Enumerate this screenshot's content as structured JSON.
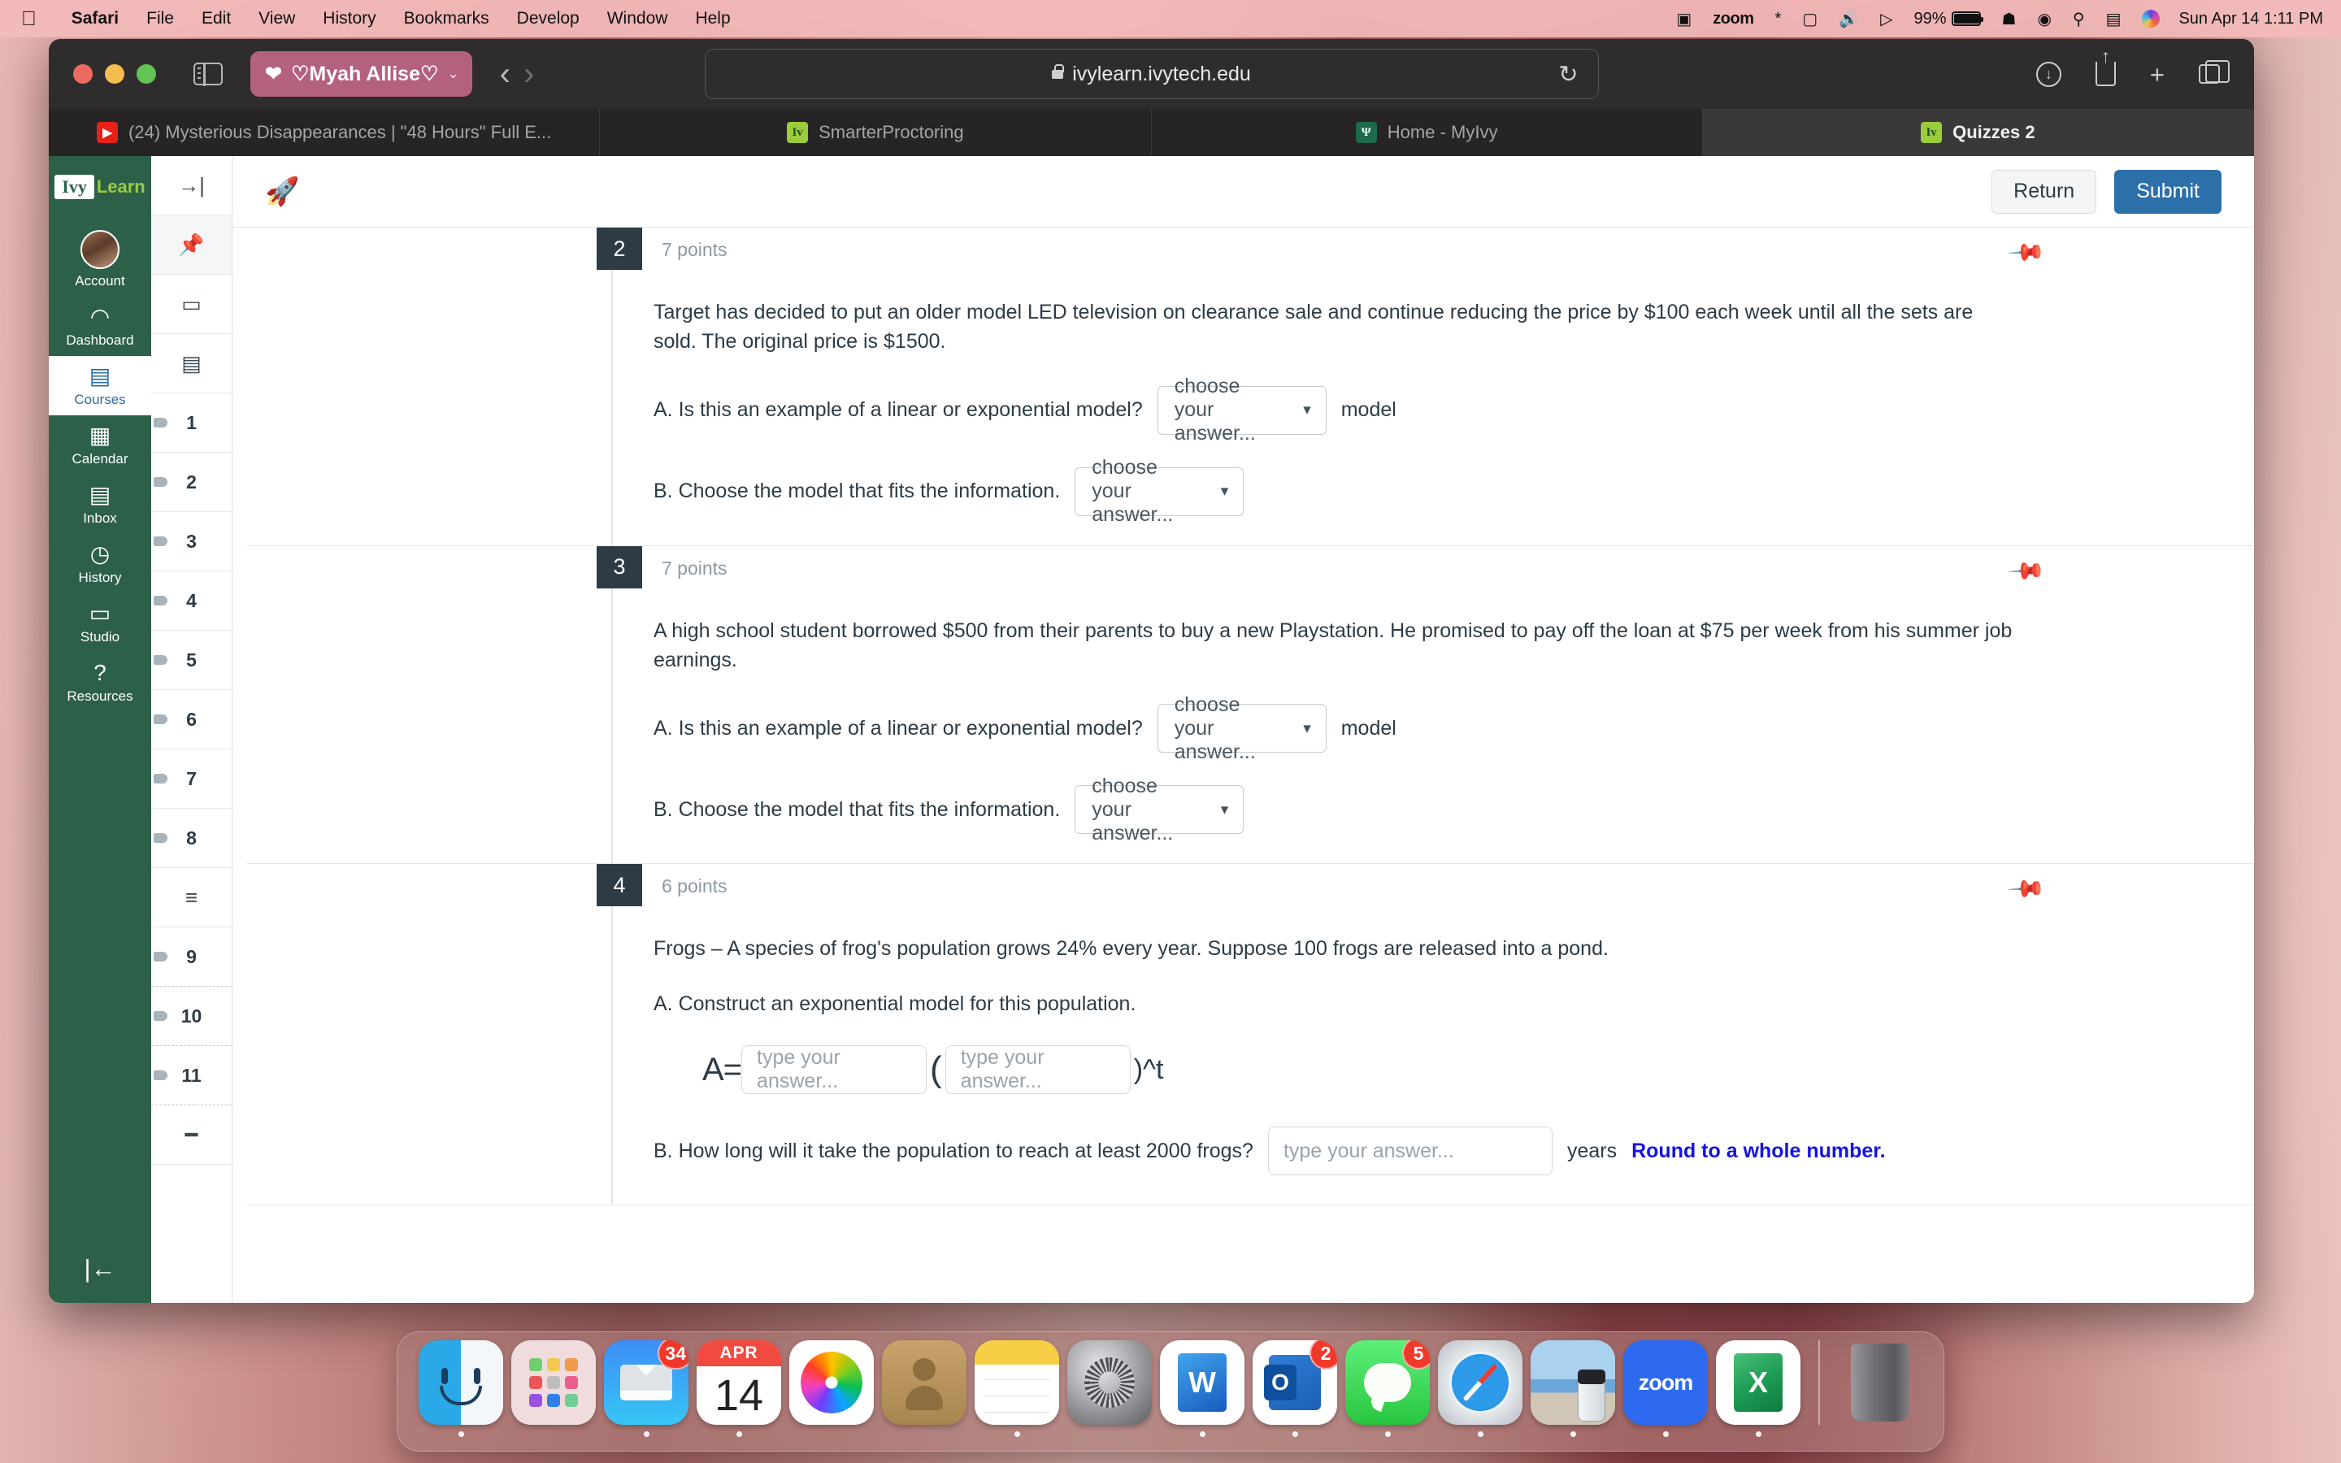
{
  "menubar": {
    "apple_icon": "apple-icon",
    "items": [
      "Safari",
      "File",
      "Edit",
      "View",
      "History",
      "Bookmarks",
      "Develop",
      "Window",
      "Help"
    ],
    "status": {
      "screenshot_icon": "screenshot-icon",
      "zoom_label": "zoom",
      "bluetooth_icon": "bluetooth-icon",
      "display_icon": "display-icon",
      "volume_icon": "volume-icon",
      "playback_icon": "playback-icon",
      "battery_percent": "99%",
      "wifi_icon": "wifi-icon",
      "user_icon": "user-icon",
      "search_icon": "search-icon",
      "controlcenter_icon": "control-center-icon",
      "siri_icon": "siri-icon",
      "clock": "Sun Apr 14  1:11 PM"
    }
  },
  "safari": {
    "sidebar_icon": "sidebar-toggle-icon",
    "profile_label": "♡Myah Allise♡",
    "profile_heart_icon": "heart-icon",
    "profile_chevron": "⌄",
    "back_icon": "‹",
    "forward_icon": "›",
    "url": "ivylearn.ivytech.edu",
    "lock_icon": "lock-icon",
    "reload_icon": "↻",
    "download_icon": "download-icon",
    "share_icon": "share-icon",
    "newtab_icon": "+",
    "tabs_overview_icon": "tab-overview-icon",
    "tabs": [
      {
        "title": "(24) Mysterious Disappearances | \"48 Hours\" Full E...",
        "favicon": "youtube-icon",
        "favicon_glyph": "▶",
        "active": false
      },
      {
        "title": "SmarterProctoring",
        "favicon": "ivylearn-icon",
        "favicon_glyph": "Iv",
        "active": false
      },
      {
        "title": "Home - MyIvy",
        "favicon": "myivy-icon",
        "favicon_glyph": "Ψ",
        "active": false
      },
      {
        "title": "Quizzes 2",
        "favicon": "ivylearn-icon",
        "favicon_glyph": "Iv",
        "active": true
      }
    ]
  },
  "ivynav": {
    "logo_ivy": "Ivy",
    "logo_learn": "Learn",
    "items": [
      {
        "label": "Account",
        "icon": "avatar-icon",
        "glyph": "",
        "selected": false
      },
      {
        "label": "Dashboard",
        "icon": "dashboard-icon",
        "glyph": "◠",
        "selected": false
      },
      {
        "label": "Courses",
        "icon": "courses-icon",
        "glyph": "▤",
        "selected": true
      },
      {
        "label": "Calendar",
        "icon": "calendar-icon",
        "glyph": "▦",
        "selected": false
      },
      {
        "label": "Inbox",
        "icon": "inbox-icon",
        "glyph": "▤",
        "selected": false
      },
      {
        "label": "History",
        "icon": "clock-icon",
        "glyph": "◷",
        "selected": false
      },
      {
        "label": "Studio",
        "icon": "studio-icon",
        "glyph": "▭",
        "selected": false
      },
      {
        "label": "Resources",
        "icon": "help-icon",
        "glyph": "?",
        "selected": false
      }
    ],
    "collapse_icon": "collapse-sidebar-icon",
    "collapse_glyph": "|←"
  },
  "qrail": {
    "rows": [
      {
        "type": "icon",
        "label": "→|",
        "name": "jump-to-icon",
        "shaded": false
      },
      {
        "type": "icon",
        "label": "📌",
        "name": "pin-icon",
        "shaded": true
      },
      {
        "type": "icon",
        "label": "▭",
        "name": "question-group-icon",
        "shaded": false
      },
      {
        "type": "icon",
        "label": "▤",
        "name": "text-block-icon",
        "shaded": false
      },
      {
        "type": "num",
        "label": "1",
        "flag": true
      },
      {
        "type": "num",
        "label": "2",
        "flag": true
      },
      {
        "type": "num",
        "label": "3",
        "flag": true
      },
      {
        "type": "num",
        "label": "4",
        "flag": true
      },
      {
        "type": "num",
        "label": "5",
        "flag": true
      },
      {
        "type": "num",
        "label": "6",
        "flag": true
      },
      {
        "type": "num",
        "label": "7",
        "flag": true
      },
      {
        "type": "num",
        "label": "8",
        "flag": true
      },
      {
        "type": "icon",
        "label": "≡",
        "name": "section-divider-icon",
        "shaded": false
      },
      {
        "type": "num",
        "label": "9",
        "flag": true,
        "dashed": true
      },
      {
        "type": "num",
        "label": "10",
        "flag": true,
        "dashed": true
      },
      {
        "type": "num",
        "label": "11",
        "flag": true,
        "dashed": true
      }
    ]
  },
  "quiz": {
    "rocket_icon": "rocket-icon",
    "return_label": "Return",
    "submit_label": "Submit",
    "pin_icon": "pin-icon",
    "questions": [
      {
        "number": "2",
        "points": "7 points",
        "text": "Target has decided to put an older model LED television on clearance sale and continue reducing the price by $100 each week until all the sets are sold.  The original price is $1500.",
        "parts": [
          {
            "label": "A.  Is this an example of a linear or exponential model?",
            "select_value": "choose your answer...",
            "suffix": "model",
            "select_width": 208
          },
          {
            "label": "B. Choose the model that fits the information.",
            "select_value": "choose your answer...",
            "suffix": "",
            "select_width": 208
          }
        ]
      },
      {
        "number": "3",
        "points": "7 points",
        "text": "A high school student borrowed $500 from their parents to buy a new Playstation. He promised to pay off the loan at $75 per week from his summer job earnings.",
        "parts": [
          {
            "label": "A. Is this an example of a linear or exponential model?",
            "select_value": "choose your answer...",
            "suffix": "model",
            "select_width": 208
          },
          {
            "label": "B. Choose the model that fits the information.",
            "select_value": "choose your answer...",
            "suffix": "",
            "select_width": 208
          }
        ]
      },
      {
        "number": "4",
        "points": "6 points",
        "text": "Frogs – A species of frog's population grows 24% every year. Suppose 100 frogs are released into a pond.",
        "partA_label": "A.  Construct an exponential model for this population.",
        "formula": {
          "prefix": "A=",
          "input1_placeholder": "type your answer...",
          "open_paren": "(",
          "input2_placeholder": "type your answer...",
          "close_paren": ")^t"
        },
        "partB_label": "B.  How long will it take the population to reach at least 2000 frogs?",
        "partB_placeholder": "type your answer...",
        "partB_unit": "years",
        "partB_hint": "Round to a whole number."
      }
    ]
  },
  "dock": {
    "items": [
      {
        "name": "finder",
        "label": "Finder",
        "running": true,
        "badge": ""
      },
      {
        "name": "launchpad",
        "label": "Launchpad",
        "running": false,
        "badge": ""
      },
      {
        "name": "mail",
        "label": "Mail",
        "running": true,
        "badge": "34"
      },
      {
        "name": "calendar",
        "label": "Calendar",
        "running": true,
        "badge": "",
        "month": "APR",
        "day": "14"
      },
      {
        "name": "photos",
        "label": "Photos",
        "running": false,
        "badge": ""
      },
      {
        "name": "contacts",
        "label": "Contacts",
        "running": false,
        "badge": ""
      },
      {
        "name": "notes",
        "label": "Notes",
        "running": true,
        "badge": ""
      },
      {
        "name": "system-settings",
        "label": "System Settings",
        "running": false,
        "badge": ""
      },
      {
        "name": "word",
        "label": "Microsoft Word",
        "running": true,
        "badge": ""
      },
      {
        "name": "outlook",
        "label": "Outlook",
        "running": true,
        "badge": "2"
      },
      {
        "name": "messages",
        "label": "Messages",
        "running": true,
        "badge": "5"
      },
      {
        "name": "safari",
        "label": "Safari",
        "running": true,
        "badge": ""
      },
      {
        "name": "preview",
        "label": "Preview",
        "running": true,
        "badge": ""
      },
      {
        "name": "zoom",
        "label": "zoom",
        "running": true,
        "badge": ""
      },
      {
        "name": "excel",
        "label": "Microsoft Excel",
        "running": true,
        "badge": ""
      },
      {
        "name": "trash",
        "label": "Trash",
        "running": false,
        "badge": ""
      }
    ]
  }
}
